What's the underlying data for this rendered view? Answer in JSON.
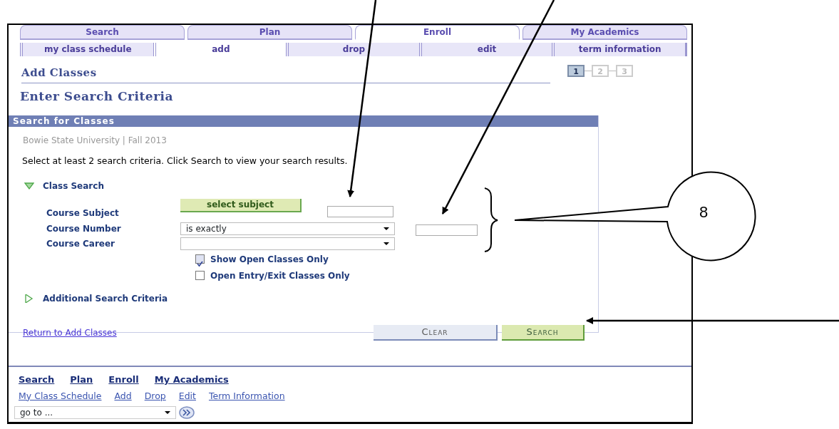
{
  "main_tabs": [
    {
      "label": "Search",
      "selected": false
    },
    {
      "label": "Plan",
      "selected": false
    },
    {
      "label": "Enroll",
      "selected": true
    },
    {
      "label": "My Academics",
      "selected": false
    }
  ],
  "sub_tabs": [
    {
      "label": "my class schedule",
      "selected": false
    },
    {
      "label": "add",
      "selected": true
    },
    {
      "label": "drop",
      "selected": false
    },
    {
      "label": "edit",
      "selected": false
    },
    {
      "label": "term information",
      "selected": false
    }
  ],
  "page_title": "Add Classes",
  "steps": [
    {
      "label": "1",
      "selected": true
    },
    {
      "label": "2",
      "selected": false
    },
    {
      "label": "3",
      "selected": false
    }
  ],
  "section_title": "Enter Search Criteria",
  "panel": {
    "title": "Search for Classes",
    "institution": "Bowie State University | Fall 2013",
    "instructions": "Select at least 2 search criteria. Click Search to view your search results.",
    "class_search": {
      "label": "Class Search",
      "expanded": true,
      "fields": [
        {
          "kind": "button_text",
          "label": "Course Subject",
          "button": "select subject"
        },
        {
          "kind": "select_text",
          "label": "Course Number",
          "value": "is exactly"
        },
        {
          "kind": "select",
          "label": "Course Career"
        }
      ],
      "checkboxes": [
        {
          "label": "Show Open Classes Only",
          "checked": true
        },
        {
          "label": "Open Entry/Exit Classes Only",
          "checked": false
        }
      ]
    },
    "additional": {
      "label": "Additional Search Criteria",
      "expanded": false
    },
    "return_link": "Return to Add Classes",
    "buttons": [
      {
        "kind": "clear",
        "label": "Clear"
      },
      {
        "kind": "search",
        "label": "Search"
      }
    ]
  },
  "footer": {
    "primary_links": [
      "Search",
      "Plan",
      "Enroll",
      "My Academics"
    ],
    "secondary_links": [
      "My Class Schedule",
      "Add",
      "Drop",
      "Edit",
      "Term Information"
    ],
    "goto": {
      "value": "go to ..."
    }
  },
  "annotation": {
    "callout": "8"
  }
}
